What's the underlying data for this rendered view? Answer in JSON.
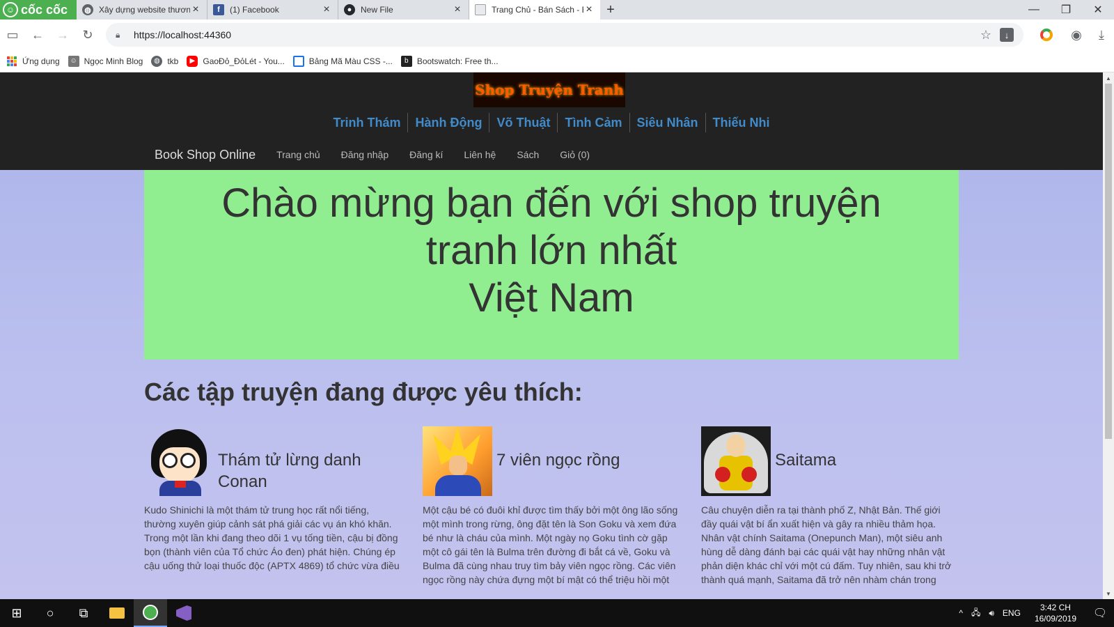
{
  "browser": {
    "brand": "cốc cốc",
    "tabs": [
      {
        "label": "Xây dựng website thương",
        "icon": "globe-icon",
        "active": false
      },
      {
        "label": "(1) Facebook",
        "icon": "facebook-icon",
        "active": false
      },
      {
        "label": "New File",
        "icon": "github-icon",
        "active": false
      },
      {
        "label": "Trang Chủ - Bán Sách - Bo",
        "icon": "document-icon",
        "active": true
      }
    ],
    "url": "https://localhost:44360",
    "bookmarks": [
      {
        "label": "Ứng dụng",
        "icon": "apps-grid-icon"
      },
      {
        "label": "Ngọc Minh Blog",
        "icon": "blog-icon"
      },
      {
        "label": "tkb",
        "icon": "globe-icon"
      },
      {
        "label": "GaoĐỏ_ĐỏLét - You...",
        "icon": "youtube-icon"
      },
      {
        "label": "Bảng Mã Màu CSS -...",
        "icon": "table-icon"
      },
      {
        "label": "Bootswatch: Free th...",
        "icon": "bootswatch-icon"
      }
    ]
  },
  "site": {
    "logo_text": "Shop Truyện Tranh",
    "genres": [
      "Trinh Thám",
      "Hành Động",
      "Võ Thuật",
      "Tình Cảm",
      "Siêu Nhân",
      "Thiếu Nhi"
    ],
    "nav": {
      "brand": "Book Shop Online",
      "links": [
        "Trang chủ",
        "Đăng nhập",
        "Đăng kí",
        "Liên hệ",
        "Sách",
        "Giỏ (0)"
      ]
    },
    "hero": {
      "line1": "Chào mừng bạn đến với shop truyện",
      "line2": "tranh lớn nhất",
      "line3": "Việt Nam",
      "background": "#90ee90"
    },
    "section_title": "Các tập truyện đang được yêu thích:",
    "comics": [
      {
        "title": "Thám tử lừng danh Conan",
        "description": "Kudo Shinichi là một thám tử trung học rất nổi tiếng, thường xuyên giúp cảnh sát phá giải các vụ án khó khăn. Trong một lần khi đang theo dõi 1 vụ tống tiền, cậu bị đồng bọn (thành viên của Tổ chức Áo đen) phát hiện. Chúng ép cậu uống thử loại thuốc độc (APTX 4869) tổ chức vừa điều"
      },
      {
        "title": "7 viên ngọc rồng",
        "description": "Một cậu bé có đuôi khỉ được tìm thấy bởi một ông lão sống một mình trong rừng, ông đặt tên là Son Goku và xem đứa bé như là cháu của mình. Một ngày nọ Goku tình cờ gặp một cô gái tên là Bulma trên đường đi bắt cá về, Goku và Bulma đã cùng nhau truy tìm bảy viên ngọc rồng. Các viên ngọc rồng này chứa đựng một bí mật có thể triệu hồi một"
      },
      {
        "title": "Saitama",
        "description": "Câu chuyện diễn ra tại thành phố Z, Nhật Bản. Thế giới đầy quái vật bí ẩn xuất hiện và gây ra nhiều thảm họa. Nhân vật chính Saitama (Onepunch Man), một siêu anh hùng dễ dàng đánh bại các quái vật hay những nhân vật phản diện khác chỉ với một cú đấm. Tuy nhiên, sau khi trở thành quá mạnh, Saitama đã trở nên nhàm chán trong"
      }
    ]
  },
  "taskbar": {
    "language": "ENG",
    "time": "3:42 CH",
    "date": "16/09/2019"
  }
}
